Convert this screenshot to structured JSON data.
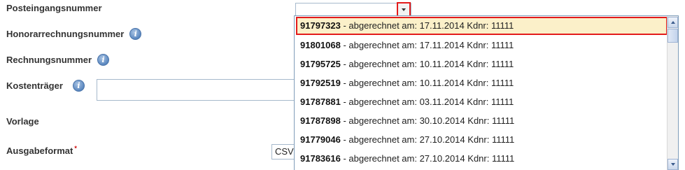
{
  "form": {
    "posteingang_label": "Posteingangsnummer",
    "honorar_label": "Honorarrechnungsnummer",
    "rechnung_label": "Rechnungsnummer",
    "kostentraeger_label": "Kostenträger",
    "vorlage_label": "Vorlage",
    "ausgabeformat_label": "Ausgabeformat",
    "required_mark": "*",
    "info_glyph": "i",
    "ausgabeformat_value": "CSV"
  },
  "dropdown": {
    "separator": " - abgerechnet am: ",
    "customer_prefix": " Kdnr: ",
    "items": [
      {
        "number": "91797323",
        "date": "17.11.2014",
        "kdnr": "11111",
        "selected": true
      },
      {
        "number": "91801068",
        "date": "17.11.2014",
        "kdnr": "11111"
      },
      {
        "number": "91795725",
        "date": "10.11.2014",
        "kdnr": "11111"
      },
      {
        "number": "91792519",
        "date": "10.11.2014",
        "kdnr": "11111"
      },
      {
        "number": "91787881",
        "date": "03.11.2014",
        "kdnr": "11111"
      },
      {
        "number": "91787898",
        "date": "30.10.2014",
        "kdnr": "11111"
      },
      {
        "number": "91779046",
        "date": "27.10.2014",
        "kdnr": "11111"
      },
      {
        "number": "91783616",
        "date": "27.10.2014",
        "kdnr": "11111"
      }
    ]
  },
  "icons": {
    "info": "info-icon",
    "dropdown_toggle": "chevron-down-icon",
    "scroll_up": "scroll-up-icon",
    "scroll_down": "scroll-down-icon"
  },
  "colors": {
    "highlight_border": "#e31b1b",
    "selected_background": "#fbf0c9",
    "required": "#cc0000"
  }
}
